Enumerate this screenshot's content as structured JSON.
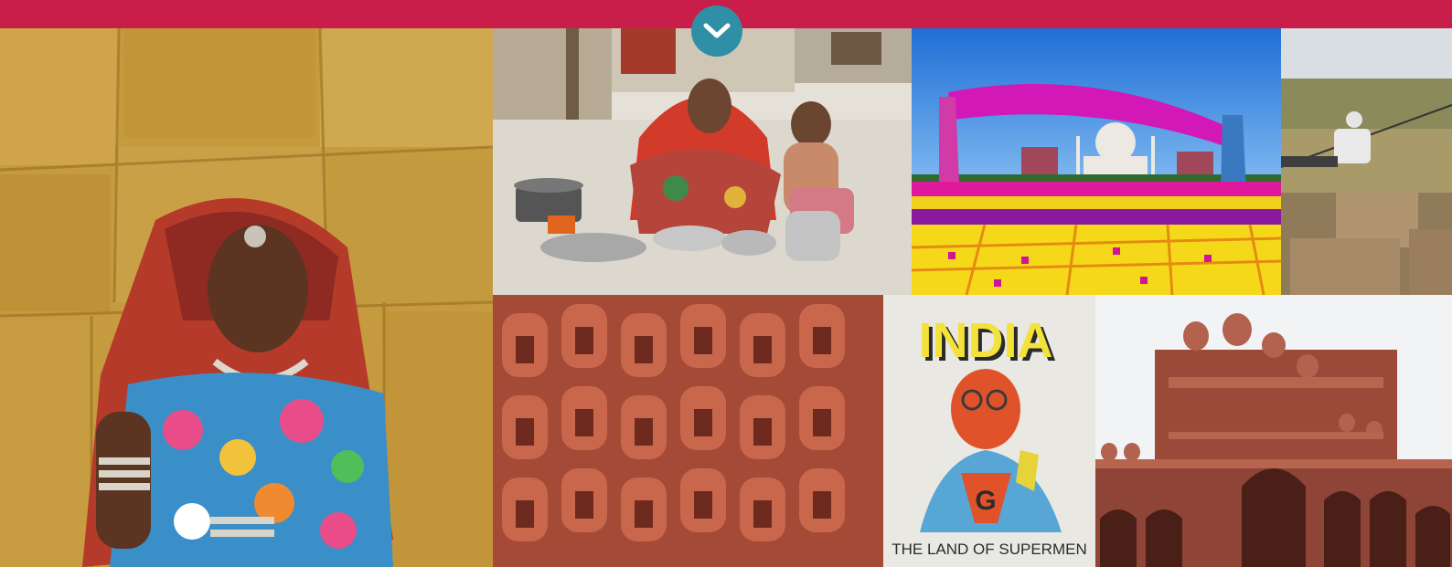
{
  "header": {
    "accent_color": "#c91d4a",
    "scroll_button_icon": "chevron-down-icon",
    "scroll_button_color": "#2f8fa6"
  },
  "gallery": {
    "tiles": [
      {
        "name": "rajasthani-woman-photo"
      },
      {
        "name": "mother-child-cooking-photo"
      },
      {
        "name": "saris-taj-mahal-photo"
      },
      {
        "name": "zipline-fort-photo"
      },
      {
        "name": "hawa-mahal-facade-photo"
      },
      {
        "name": "india-poster-photo",
        "poster_title": "INDIA",
        "poster_caption": "THE LAND OF SUPERMEN",
        "emblem_letter": "G"
      },
      {
        "name": "fatehpur-sikri-gate-photo"
      }
    ]
  }
}
